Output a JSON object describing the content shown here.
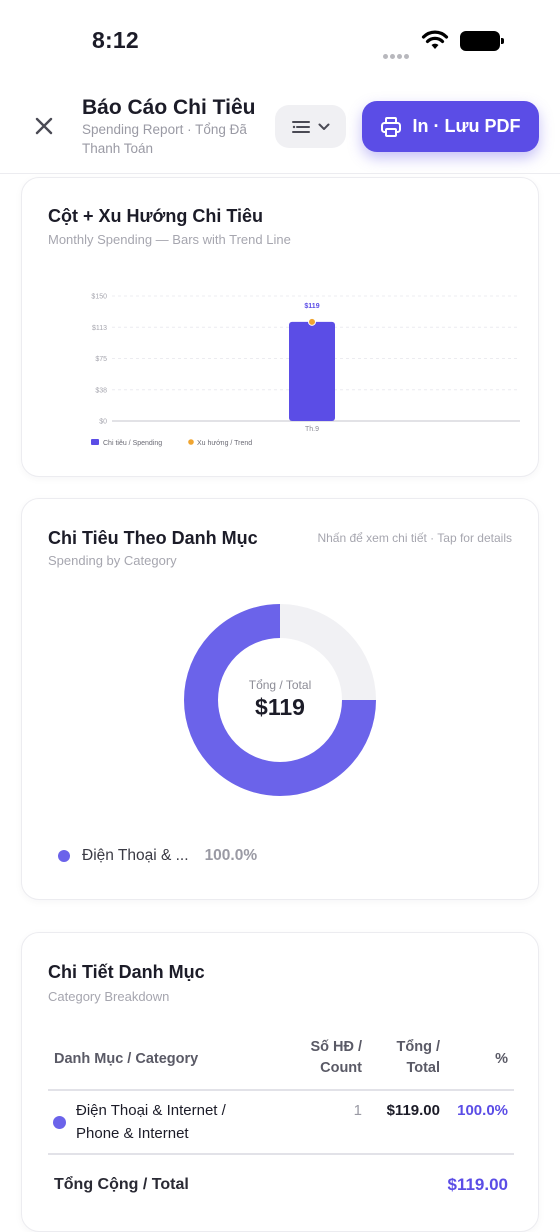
{
  "status_bar": {
    "time": "8:12"
  },
  "header": {
    "title": "Báo Cáo Chi Tiêu",
    "subtitle": "Spending Report · Tổng Đã Thanh Toán",
    "pdf_button": "In · Lưu PDF"
  },
  "trend_card": {
    "title": "Cột + Xu Hướng Chi Tiêu",
    "subtitle": "Monthly Spending — Bars with Trend Line",
    "legend_bar": "Chi tiêu / Spending",
    "legend_trend": "Xu hướng / Trend"
  },
  "chart_data": {
    "type": "bar",
    "categories": [
      "Th.9"
    ],
    "series": [
      {
        "name": "Chi tiêu / Spending",
        "type": "bar",
        "values": [
          119
        ]
      },
      {
        "name": "Xu hướng / Trend",
        "type": "line",
        "values": [
          119
        ]
      }
    ],
    "data_labels": [
      "$119"
    ],
    "yticks": [
      "$0",
      "$38",
      "$75",
      "$113",
      "$150"
    ],
    "ylim": [
      0,
      150
    ],
    "grid": true,
    "legend_position": "bottom-left",
    "colors": {
      "bar": "#5b4de6",
      "trend": "#f0a530"
    }
  },
  "category_card": {
    "title": "Chi Tiêu Theo Danh Mục",
    "subtitle": "Spending by Category",
    "hint": "Nhấn để xem chi tiết · Tap for details",
    "center_label": "Tổng / Total",
    "center_value": "$119",
    "donut_fraction": 0.75,
    "legend": [
      {
        "name": "Điện Thoại & ...",
        "pct": "100.0%"
      }
    ],
    "colors": {
      "slice": "#6b63ea",
      "track": "#f1f1f4"
    }
  },
  "breakdown_card": {
    "title": "Chi Tiết Danh Mục",
    "subtitle": "Category Breakdown",
    "columns": {
      "category": "Danh Mục / Category",
      "count_line1": "Số HĐ /",
      "count_line2": "Count",
      "total_line1": "Tổng /",
      "total_line2": "Total",
      "pct": "%"
    },
    "rows": [
      {
        "name_line1": "Điện Thoại & Internet /",
        "name_line2": "Phone & Internet",
        "count": "1",
        "total": "$119.00",
        "pct": "100.0%"
      }
    ],
    "footer_label": "Tổng Cộng / Total",
    "footer_total": "$119.00",
    "accent": "#5b4de6"
  }
}
